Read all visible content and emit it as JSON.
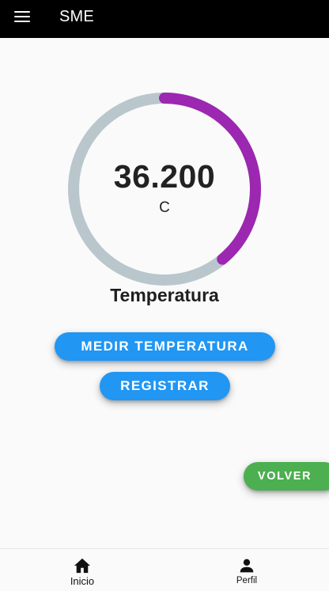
{
  "app": {
    "title": "SME",
    "menu_icon": "menu-icon"
  },
  "gauge": {
    "value": "36.200",
    "unit": "C",
    "label": "Temperatura",
    "progress_fraction": 0.39,
    "track_color": "#b9c7cc",
    "progress_color": "#9c27b0"
  },
  "actions": {
    "measure_label": "MEDIR TEMPERATURA",
    "register_label": "REGISTRAR",
    "back_label": "VOLVER"
  },
  "colors": {
    "primary_button": "#2196f3",
    "back_button": "#4caf50",
    "appbar": "#000000"
  },
  "bottom_nav": {
    "items": [
      {
        "label": "Inicio",
        "icon": "home-icon",
        "active": true
      },
      {
        "label": "Perfil",
        "icon": "person-icon",
        "active": false
      }
    ]
  }
}
